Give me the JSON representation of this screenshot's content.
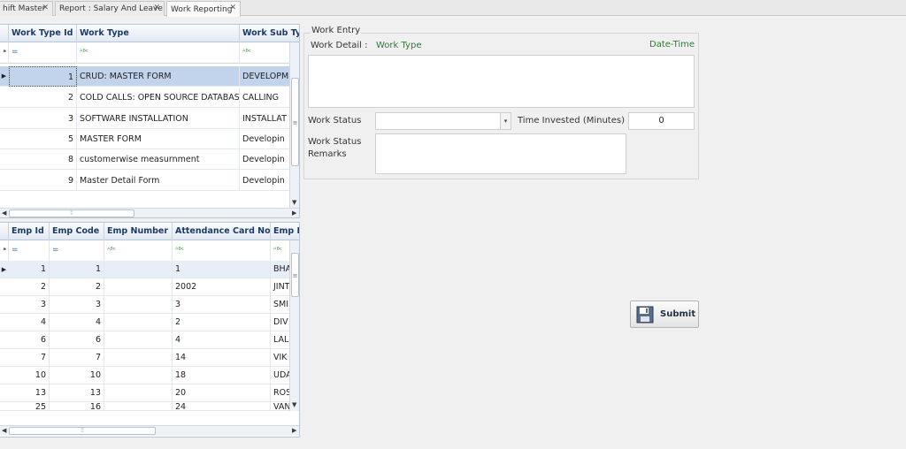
{
  "tabs": [
    {
      "label": "hift Master",
      "active": false
    },
    {
      "label": "Report : Salary And Leave",
      "active": false
    },
    {
      "label": "Work Reporting",
      "active": true
    }
  ],
  "close_glyph": "✕",
  "work_grid": {
    "columns": [
      "Work Type Id",
      "Work Type",
      "Work Sub Typ"
    ],
    "filter": [
      "=",
      "ᴬᴮᶜ",
      "ᴬᴮᶜ"
    ],
    "rows": [
      {
        "id": "1",
        "type": "CRUD: MASTER FORM",
        "sub": "DEVELOPM",
        "selected": true
      },
      {
        "id": "2",
        "type": "COLD CALLS: OPEN SOURCE DATABASE",
        "sub": "CALLING",
        "selected": false
      },
      {
        "id": "3",
        "type": "SOFTWARE INSTALLATION",
        "sub": "INSTALLAT",
        "selected": false
      },
      {
        "id": "5",
        "type": "MASTER FORM",
        "sub": "Developin",
        "selected": false
      },
      {
        "id": "8",
        "type": "customerwise measurnment",
        "sub": "Developin",
        "selected": false
      },
      {
        "id": "9",
        "type": "Master Detail Form",
        "sub": "Developin",
        "selected": false
      }
    ]
  },
  "emp_grid": {
    "columns": [
      "Emp Id",
      "Emp Code",
      "Emp Number",
      "Attendance Card No",
      "Emp N"
    ],
    "filter": [
      "=",
      "=",
      "ᴬᴮᶜ",
      "ᴬᴮᶜ",
      "ᴬᴮᶜ"
    ],
    "rows": [
      [
        "1",
        "1",
        "",
        "1",
        "BHA"
      ],
      [
        "2",
        "2",
        "",
        "2002",
        "JINT"
      ],
      [
        "3",
        "3",
        "",
        "3",
        "SMI"
      ],
      [
        "4",
        "4",
        "",
        "2",
        "DIV"
      ],
      [
        "6",
        "6",
        "",
        "4",
        "LAL"
      ],
      [
        "7",
        "7",
        "",
        "14",
        "VIK"
      ],
      [
        "10",
        "10",
        "",
        "18",
        "UDA"
      ],
      [
        "13",
        "13",
        "",
        "20",
        "ROS"
      ],
      [
        "25",
        "16",
        "",
        "24",
        "VAN"
      ]
    ]
  },
  "work_entry": {
    "title": "Work Entry",
    "detail_label": "Work Detail :",
    "work_type_label": "Work Type",
    "datetime_label": "Date-Time",
    "status_label": "Work Status",
    "status_value": "",
    "time_label": "Time Invested (Minutes)",
    "time_value": "0",
    "remarks_label_1": "Work Status",
    "remarks_label_2": "Remarks",
    "remarks_value": ""
  },
  "submit_label": "Submit",
  "colors": {
    "selection": "#c2d4ec",
    "header_text": "#1f3b63",
    "green_label": "#2e7d32"
  }
}
